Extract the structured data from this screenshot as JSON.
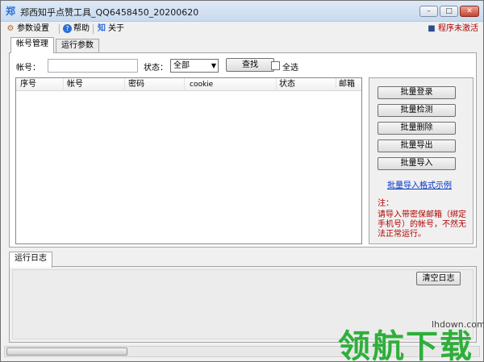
{
  "window": {
    "title": "郑西知乎点赞工具_QQ6458450_20200620",
    "app_icon": "郑",
    "min_glyph": "–",
    "max_glyph": "□",
    "close_glyph": "✕"
  },
  "toolbar": {
    "items": [
      {
        "icon": "gear-icon",
        "glyph": "⚙",
        "label": "参数设置"
      },
      {
        "icon": "help-icon",
        "glyph": "?",
        "label": "帮助"
      },
      {
        "icon": "zhihu-icon",
        "glyph": "知",
        "label": "关于"
      }
    ],
    "status": {
      "icon": "book-icon",
      "glyph": "■",
      "label": "程序未激活"
    }
  },
  "tabs": [
    {
      "label": "帐号管理",
      "active": true
    },
    {
      "label": "运行参数",
      "active": false
    }
  ],
  "filter": {
    "account_label": "帐号：",
    "account_value": "",
    "status_label": "状态：",
    "status_selected": "全部",
    "search_button": "查找",
    "select_all_label": "全选"
  },
  "table": {
    "columns": [
      "序号",
      "帐号",
      "密码",
      "cookie",
      "状态",
      "邮箱"
    ],
    "rows": []
  },
  "side_actions": {
    "buttons": [
      "批量登录",
      "批量检测",
      "批量删除",
      "批量导出",
      "批量导入"
    ],
    "example_link": "批量导入格式示例",
    "note_label": "注：",
    "note_text": "请导入带密保邮箱（绑定手机号）的帐号，不然无法正常运行。"
  },
  "log": {
    "tab_label": "运行日志",
    "clear_button": "清空日志"
  },
  "watermark": {
    "brand": "领航下载",
    "site": "lhdown.com"
  },
  "colors": {
    "status_text": "#b00000",
    "link": "#0033cc",
    "watermark": "#2eaf3a"
  }
}
